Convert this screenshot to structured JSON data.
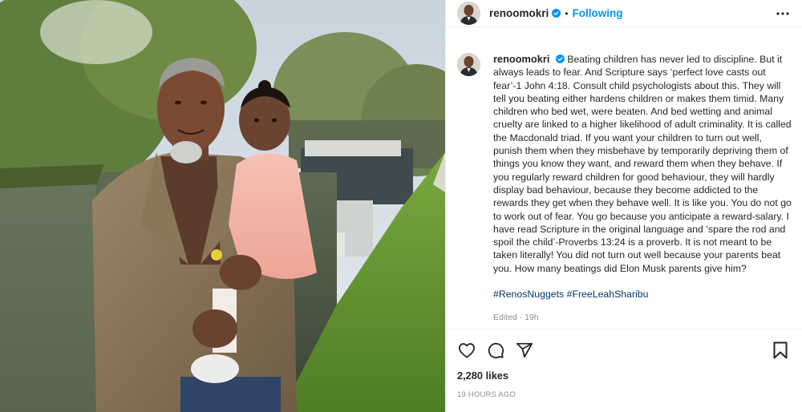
{
  "post": {
    "username": "renoomokri",
    "follow_label": "Following",
    "dot": "•",
    "caption_text": "Beating children has never led to discipline. But it always leads to fear. And Scripture says ‘perfect love casts out fear’-1 John 4:18. Consult child psychologists about this. They will tell you beating either hardens children or makes them timid. Many children who bed wet, were beaten. And bed wetting and animal cruelty are linked to a higher likelihood of adult criminality. It is called the Macdonald triad. If you want your children to turn out well, punish them when they misbehave by temporarily depriving them of things you know they want, and reward them when they behave. If you regularly reward children for good behaviour, they will hardly display bad behaviour, because they become addicted to the rewards they get when they behave well. It is like you. You do not go to work out of fear. You go because you anticipate a reward-salary. I have read Scripture in the original language and ‘spare the rod and spoil the child’-Proverbs 13:24 is a proverb. It is not meant to be taken literally! You did not turn out well because your parents beat you. How many beatings did Elon Musk parents give him?",
    "hashtags": [
      "#RenosNuggets",
      "#FreeLeahSharibu"
    ],
    "edited": "Edited · 19h",
    "likes": "2,280 likes",
    "timestamp": "19 HOURS AGO"
  },
  "icons": {
    "verified": "verified-badge-icon",
    "more": "more-options-icon",
    "like": "heart-icon",
    "comment": "comment-icon",
    "share": "share-icon",
    "save": "bookmark-icon"
  },
  "colors": {
    "accent": "#0095f6",
    "hashtag": "#00376b",
    "muted": "#8e8e8e",
    "text": "#262626",
    "border": "#efefef"
  }
}
